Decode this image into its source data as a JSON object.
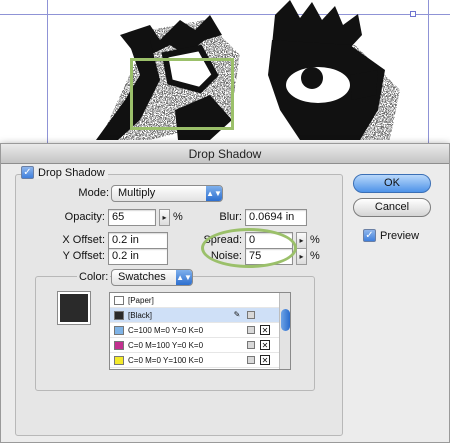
{
  "dialog": {
    "title": "Drop Shadow",
    "enable_label": "Drop Shadow",
    "enable_checked": true
  },
  "fields": {
    "mode_label": "Mode:",
    "mode_value": "Multiply",
    "opacity_label": "Opacity:",
    "opacity_value": "65",
    "opacity_unit": "%",
    "blur_label": "Blur:",
    "blur_value": "0.0694 in",
    "x_offset_label": "X Offset:",
    "x_offset_value": "0.2 in",
    "spread_label": "Spread:",
    "spread_value": "0",
    "spread_unit": "%",
    "y_offset_label": "Y Offset:",
    "y_offset_value": "0.2 in",
    "noise_label": "Noise:",
    "noise_value": "75",
    "noise_unit": "%",
    "color_label": "Color:",
    "color_value": "Swatches"
  },
  "swatches": [
    {
      "name": "[Paper]",
      "color": "#ffffff"
    },
    {
      "name": "[Black]",
      "color": "#2a2a2a",
      "selected": true
    },
    {
      "name": "C=100 M=0 Y=0 K=0",
      "color": "#7fb3e6"
    },
    {
      "name": "C=0 M=100 Y=0 K=0",
      "color": "#c2308f"
    },
    {
      "name": "C=0 M=0 Y=100 K=0",
      "color": "#f4ea2a"
    }
  ],
  "buttons": {
    "ok": "OK",
    "cancel": "Cancel",
    "preview_label": "Preview",
    "preview_checked": true
  },
  "colors": {
    "highlight": "#9bc06a",
    "accent": "#3f80dd"
  }
}
